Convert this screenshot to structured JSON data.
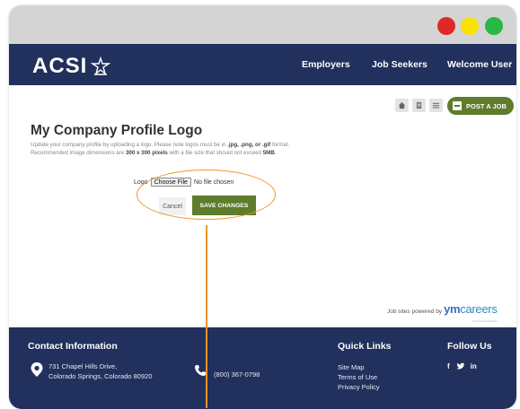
{
  "window": {
    "colors": {
      "close": "#e02828",
      "minimize": "#f7e300",
      "maximize": "#29b845"
    }
  },
  "nav": {
    "logo": "ACSI",
    "links": [
      "Employers",
      "Job Seekers",
      "Welcome User"
    ],
    "bg_color": "#21305c"
  },
  "toolbar": {
    "icons": [
      "home-icon",
      "document-icon",
      "list-icon"
    ],
    "post_job_label": "POST A JOB",
    "accent": "#5e7c2c"
  },
  "page": {
    "title": "My Company Profile Logo",
    "desc_1": "Update your company profile by uploading a logo. Please note logos must be in",
    "formats": ".jpg, .png, or .gif",
    "desc_1b": "format.",
    "desc_2": "Recommended image dimensions are",
    "dims": "300 x 300 pixels",
    "desc_2b": "with a file size that should not exceed",
    "size": "5MB",
    "desc_2c": "."
  },
  "form": {
    "logo_label": "Logo",
    "choose_file_label": "Choose File",
    "file_status": "No file chosen",
    "cancel_label": "Cancel",
    "save_label": "SAVE CHANGES"
  },
  "powered": {
    "text": "Job sites powered by",
    "brand_ym": "ym",
    "brand_rest": "careers",
    "brand_sub": "by communitybrands"
  },
  "footer": {
    "contact_heading": "Contact Information",
    "address_line1": "731 Chapel Hills Drive,",
    "address_line2": "Colorado Springs, Colorado 80920",
    "phone": "(800) 367-0798",
    "links_heading": "Quick Links",
    "links": [
      "Site Map",
      "Terms of Use",
      "Privacy Policy"
    ],
    "follow_heading": "Follow Us",
    "social": [
      "f",
      "𝕪",
      "in"
    ],
    "social_icons": [
      "facebook-icon",
      "twitter-icon",
      "linkedin-icon"
    ]
  },
  "annotation_color": "#ee9327"
}
